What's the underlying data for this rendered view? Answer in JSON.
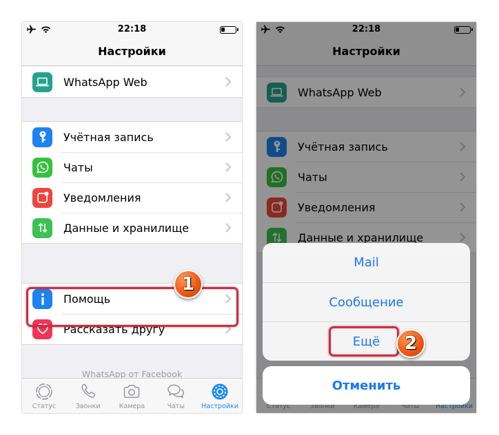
{
  "status_bar": {
    "time": "22:18"
  },
  "nav": {
    "title": "Настройки"
  },
  "settings": {
    "group1": [
      {
        "label": "WhatsApp Web",
        "icon": "laptop-icon",
        "color": "#25a28d"
      }
    ],
    "group2": [
      {
        "label": "Учётная запись",
        "icon": "key-icon",
        "color": "#1e82f0"
      },
      {
        "label": "Чаты",
        "icon": "whatsapp-icon",
        "color": "#34c23d"
      },
      {
        "label": "Уведомления",
        "icon": "notifications-icon",
        "color": "#f0453a"
      },
      {
        "label": "Данные и хранилище",
        "icon": "data-arrows-icon",
        "color": "#3cc154"
      }
    ],
    "group3": [
      {
        "label": "Помощь",
        "icon": "info-icon",
        "color": "#1e82f0"
      },
      {
        "label": "Рассказать другу",
        "icon": "heart-icon",
        "color": "#f0355a"
      }
    ],
    "footer": "WhatsApp от Facebook"
  },
  "tabbar": [
    {
      "label": "Статус",
      "icon": "status-icon",
      "active": false
    },
    {
      "label": "Звонки",
      "icon": "phone-icon",
      "active": false
    },
    {
      "label": "Камера",
      "icon": "camera-icon",
      "active": false
    },
    {
      "label": "Чаты",
      "icon": "chats-icon",
      "active": false
    },
    {
      "label": "Настройки",
      "icon": "settings-gear-icon",
      "active": true
    }
  ],
  "share_sheet": {
    "options": [
      "Mail",
      "Сообщение",
      "Ещё"
    ],
    "cancel": "Отменить"
  },
  "annotations": {
    "step1": "1",
    "step2": "2"
  },
  "colors": {
    "accent": "#1a88f5",
    "highlight": "#d6293f",
    "badge": "#f05a14"
  }
}
